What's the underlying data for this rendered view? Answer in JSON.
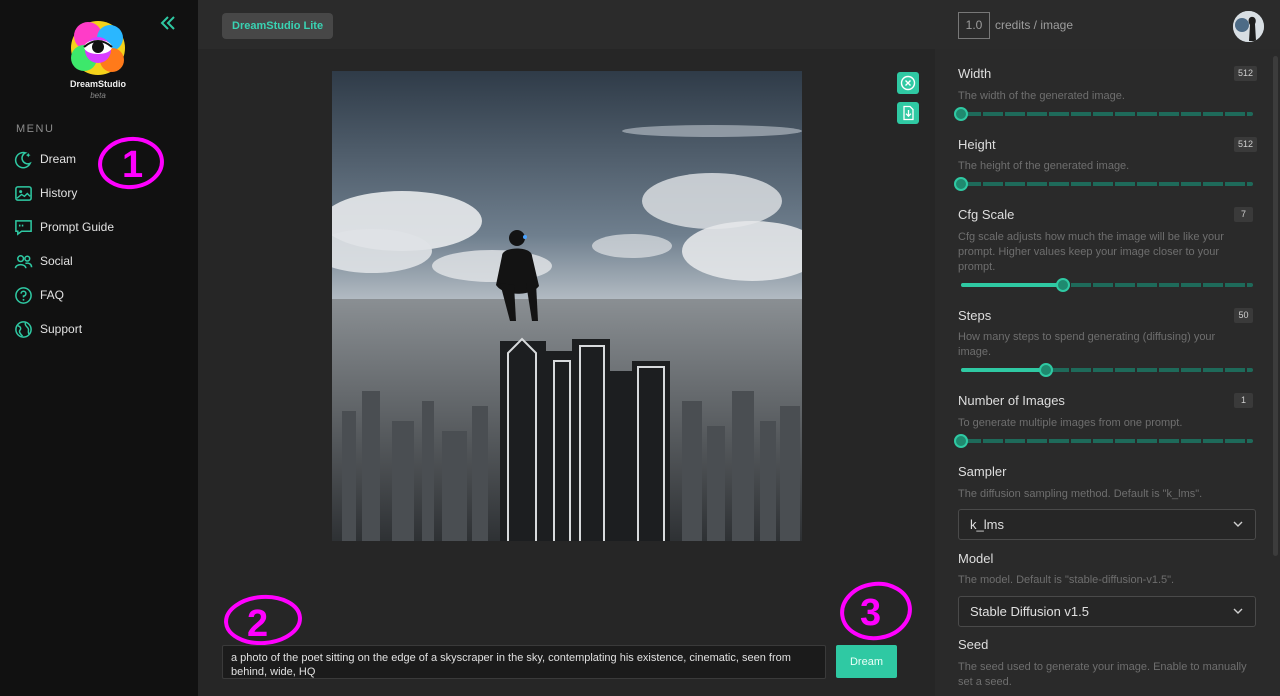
{
  "brand": {
    "name": "DreamStudio",
    "tag": "beta"
  },
  "sidebar": {
    "menu_label": "MENU",
    "items": [
      {
        "label": "Dream",
        "icon": "moon-stars-icon"
      },
      {
        "label": "History",
        "icon": "image-icon"
      },
      {
        "label": "Prompt Guide",
        "icon": "chat-bubble-icon"
      },
      {
        "label": "Social",
        "icon": "users-icon"
      },
      {
        "label": "FAQ",
        "icon": "question-icon"
      },
      {
        "label": "Support",
        "icon": "globe-icon"
      }
    ]
  },
  "topbar": {
    "badge": "DreamStudio Lite",
    "credits_value": "1.0",
    "credits_label": "credits / image"
  },
  "prompt": {
    "text": "a photo of the poet sitting on the edge of a skyscraper in the sky, contemplating his existence, cinematic, seen from behind, wide, HQ",
    "button": "Dream"
  },
  "annotations": [
    "1",
    "2",
    "3"
  ],
  "settings": {
    "width": {
      "title": "Width",
      "desc": "The width of the generated image.",
      "value": "512",
      "level": 0.0
    },
    "height": {
      "title": "Height",
      "desc": "The height of the generated image.",
      "value": "512",
      "level": 0.0
    },
    "cfg": {
      "title": "Cfg Scale",
      "desc": "Cfg scale adjusts how much the image will be like your prompt. Higher values keep your image closer to your prompt.",
      "value": "7",
      "level": 0.35
    },
    "steps": {
      "title": "Steps",
      "desc": "How many steps to spend generating (diffusing) your image.",
      "value": "50",
      "level": 0.29
    },
    "num_images": {
      "title": "Number of Images",
      "desc": "To generate multiple images from one prompt.",
      "value": "1",
      "level": 0.0
    },
    "sampler": {
      "title": "Sampler",
      "desc": "The diffusion sampling method. Default is \"k_lms\".",
      "value": "k_lms"
    },
    "model": {
      "title": "Model",
      "desc": "The model. Default is \"stable-diffusion-v1.5\".",
      "value": "Stable Diffusion v1.5"
    },
    "seed": {
      "title": "Seed",
      "desc": "The seed used to generate your image. Enable to manually set a seed."
    }
  },
  "colors": {
    "accent": "#2fc9a3",
    "annotation": "#ff00ff",
    "sidebar_bg": "#111111",
    "panel_bg": "#2a2a2a"
  }
}
